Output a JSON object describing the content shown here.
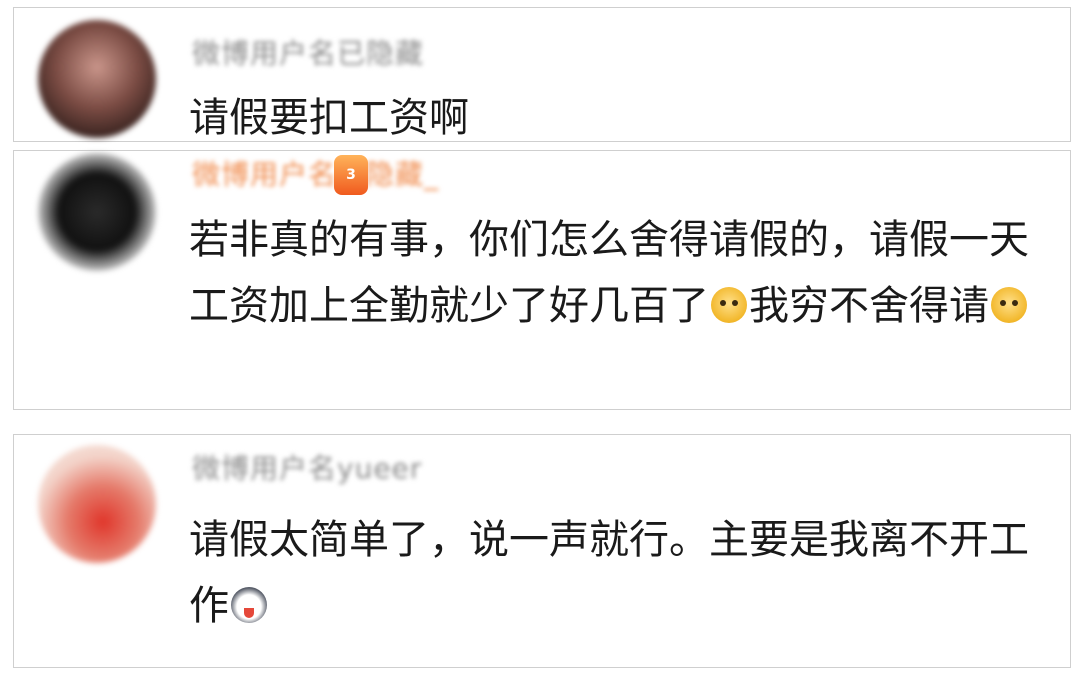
{
  "comments": [
    {
      "username": "微博用户名已隐藏",
      "text_parts": [
        "请假要扣工资啊"
      ]
    },
    {
      "username": "微博用户名已隐藏_",
      "badge": "3",
      "text_parts": [
        "若非真的有事，你们怎么舍得请假的，请假一天工资加上全勤就少了好几百了",
        "我穷不舍得请",
        ""
      ]
    },
    {
      "username": "微博用户名yueer",
      "text_parts": [
        "请假太简单了，说一声就行。主要是我离不开工作",
        ""
      ]
    }
  ],
  "emojis": {
    "c2_e1": "crying-dog-icon",
    "c2_e2": "crying-dog-icon",
    "c3_e1": "husky-tongue-icon"
  }
}
